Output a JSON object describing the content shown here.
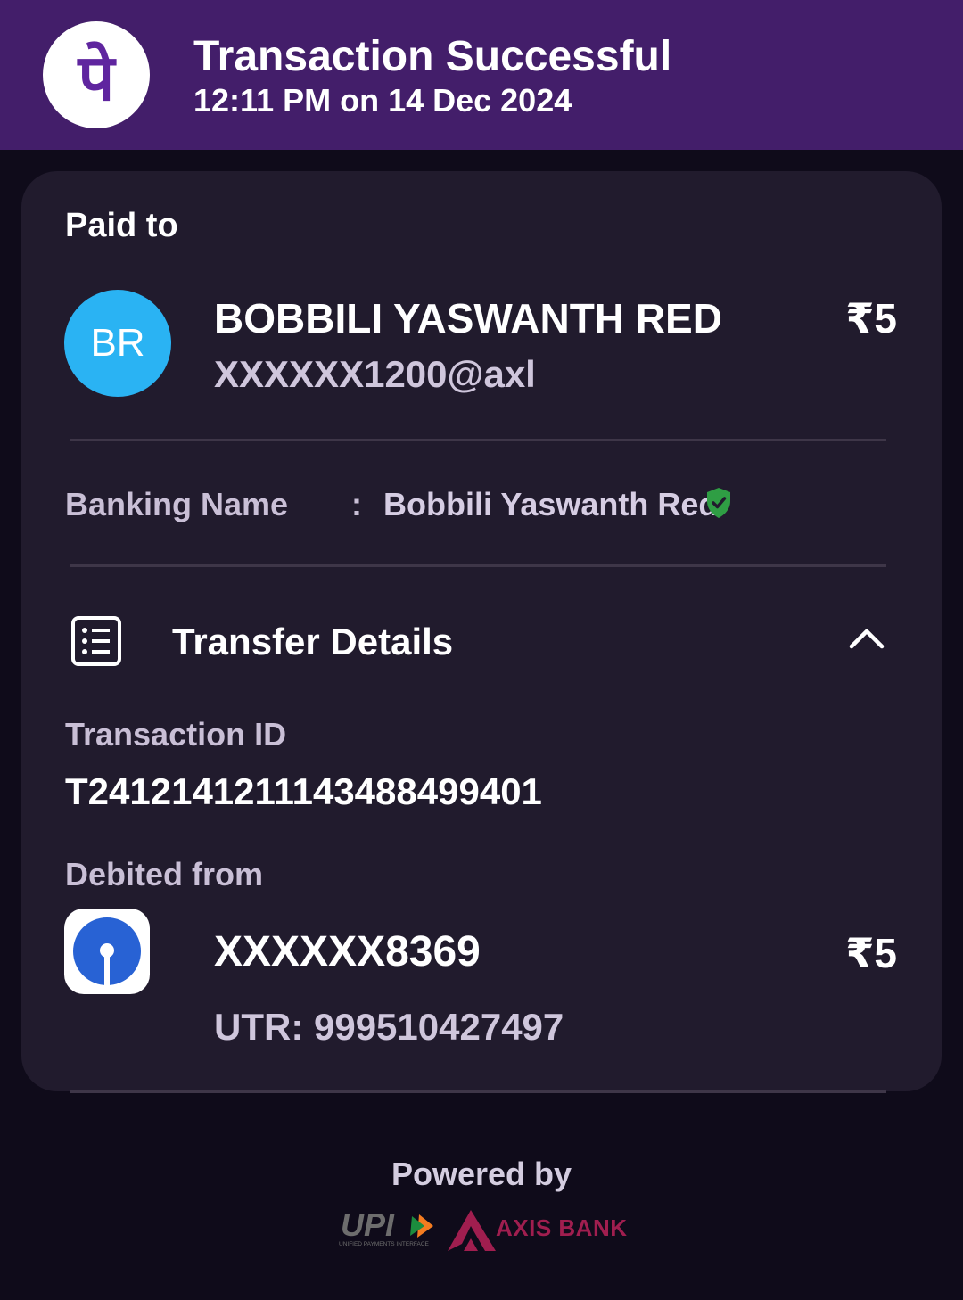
{
  "header": {
    "logo_glyph": "पे",
    "title": "Transaction Successful",
    "datetime": "12:11 PM on 14 Dec 2024"
  },
  "paid_to": {
    "label": "Paid to",
    "avatar_initials": "BR",
    "name": "BOBBILI YASWANTH RED",
    "upi_id": "XXXXXX1200@axl",
    "amount": "₹5"
  },
  "banking_name": {
    "label": "Banking Name",
    "separator": ":",
    "value": "Bobbili Yaswanth Red",
    "verified_icon": "shield-check-icon"
  },
  "transfer_details": {
    "title": "Transfer Details",
    "icon": "receipt-list-icon",
    "toggle_icon": "chevron-up-icon",
    "transaction_id_label": "Transaction ID",
    "transaction_id": "T2412141211143488499401",
    "debited_from_label": "Debited from",
    "account": "XXXXXX8369",
    "amount": "₹5",
    "utr": "UTR: 999510427497"
  },
  "footer": {
    "powered_by": "Powered by",
    "upi_logo_text": "UPI",
    "upi_tagline": "UNIFIED PAYMENTS INTERFACE",
    "bank_name": "AXIS BANK"
  },
  "colors": {
    "header_bg": "#431e6a",
    "page_bg": "#0f0b1a",
    "card_bg": "#211b2d",
    "avatar_bg": "#2ab3f3",
    "verified_green": "#2f9e44",
    "axis_maroon": "#a01e4f",
    "sbi_blue": "#2862d4"
  }
}
